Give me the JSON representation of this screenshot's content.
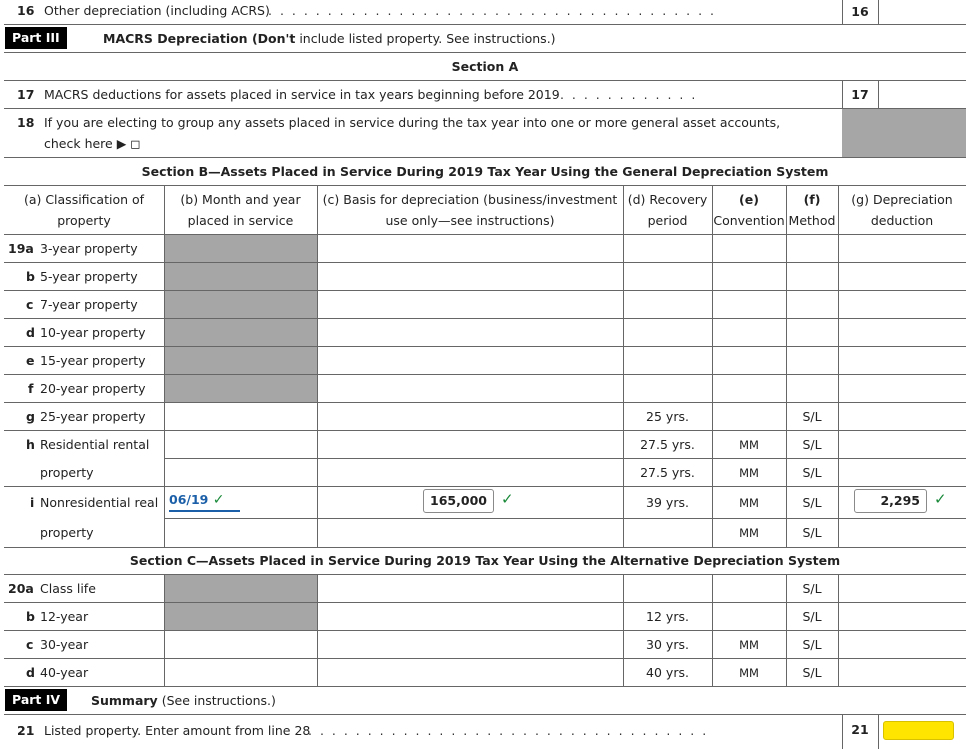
{
  "line16": {
    "num": "16",
    "text": "Other depreciation (including ACRS)",
    "box": "16"
  },
  "part3": {
    "label": "Part III",
    "title_bold": "MACRS Depreciation (Don't",
    "title_rest": "include listed property. See instructions.)"
  },
  "sectionA": {
    "title": "Section A"
  },
  "line17": {
    "num": "17",
    "text": "MACRS deductions for assets placed in service in tax years beginning before 2019",
    "box": "17"
  },
  "line18": {
    "num": "18",
    "text1": "If you are electing to group any assets placed in service during the tax year into one or more general asset accounts,",
    "text2": "check here ▶ ◻"
  },
  "sectionB": {
    "title": "Section B—Assets Placed in Service During 2019 Tax Year Using the General Depreciation System"
  },
  "columns": {
    "a1": "(a) Classification of",
    "a2": "property",
    "b1": "(b) Month and year",
    "b2": "placed in service",
    "c1": "(c) Basis for depreciation (business/investment",
    "c2": "use only—see instructions)",
    "d1": "(d) Recovery",
    "d2": "period",
    "e1": "(e)",
    "e2": "Convention",
    "f1": "(f)",
    "f2": "Method",
    "g1": "(g) Depreciation",
    "g2": "deduction"
  },
  "rows19": [
    {
      "num": "19a",
      "label": "3-year property"
    },
    {
      "num": "b",
      "label": "5-year property"
    },
    {
      "num": "c",
      "label": "7-year property"
    },
    {
      "num": "d",
      "label": "10-year property"
    },
    {
      "num": "e",
      "label": "15-year property"
    },
    {
      "num": "f",
      "label": "20-year property"
    },
    {
      "num": "g",
      "label": "25-year property",
      "period": "25 yrs.",
      "method": "S/L"
    },
    {
      "num": "h",
      "label": "Residential rental",
      "period": "27.5 yrs.",
      "convention": "MM",
      "method": "S/L"
    },
    {
      "label": "property",
      "period": "27.5 yrs.",
      "convention": "MM",
      "method": "S/L"
    },
    {
      "num": "i",
      "label": "Nonresidential real",
      "date": "06/19",
      "basis": "165,000",
      "period": "39 yrs.",
      "convention": "MM",
      "method": "S/L",
      "deduction": "2,295"
    },
    {
      "label": "property",
      "convention": "MM",
      "method": "S/L"
    }
  ],
  "checkmark": "✓",
  "sectionC": {
    "title": "Section C—Assets Placed in Service During 2019 Tax Year Using the Alternative Depreciation System"
  },
  "rows20": [
    {
      "num": "20a",
      "label": "Class life",
      "method": "S/L"
    },
    {
      "num": "b",
      "label": "12-year",
      "period": "12 yrs.",
      "method": "S/L"
    },
    {
      "num": "c",
      "label": "30-year",
      "period": "30 yrs.",
      "convention": "MM",
      "method": "S/L"
    },
    {
      "num": "d",
      "label": "40-year",
      "period": "40 yrs.",
      "convention": "MM",
      "method": "S/L"
    }
  ],
  "part4": {
    "label": "Part IV",
    "title_bold": "Summary",
    "title_rest": "(See instructions.)"
  },
  "line21": {
    "num": "21",
    "text": "Listed property. Enter amount from line 28",
    "box": "21"
  },
  "colors": {
    "accent": "#1b5fa8",
    "check": "#1a8a3a",
    "highlight": "#ffe500",
    "shade": "#a6a6a6"
  }
}
